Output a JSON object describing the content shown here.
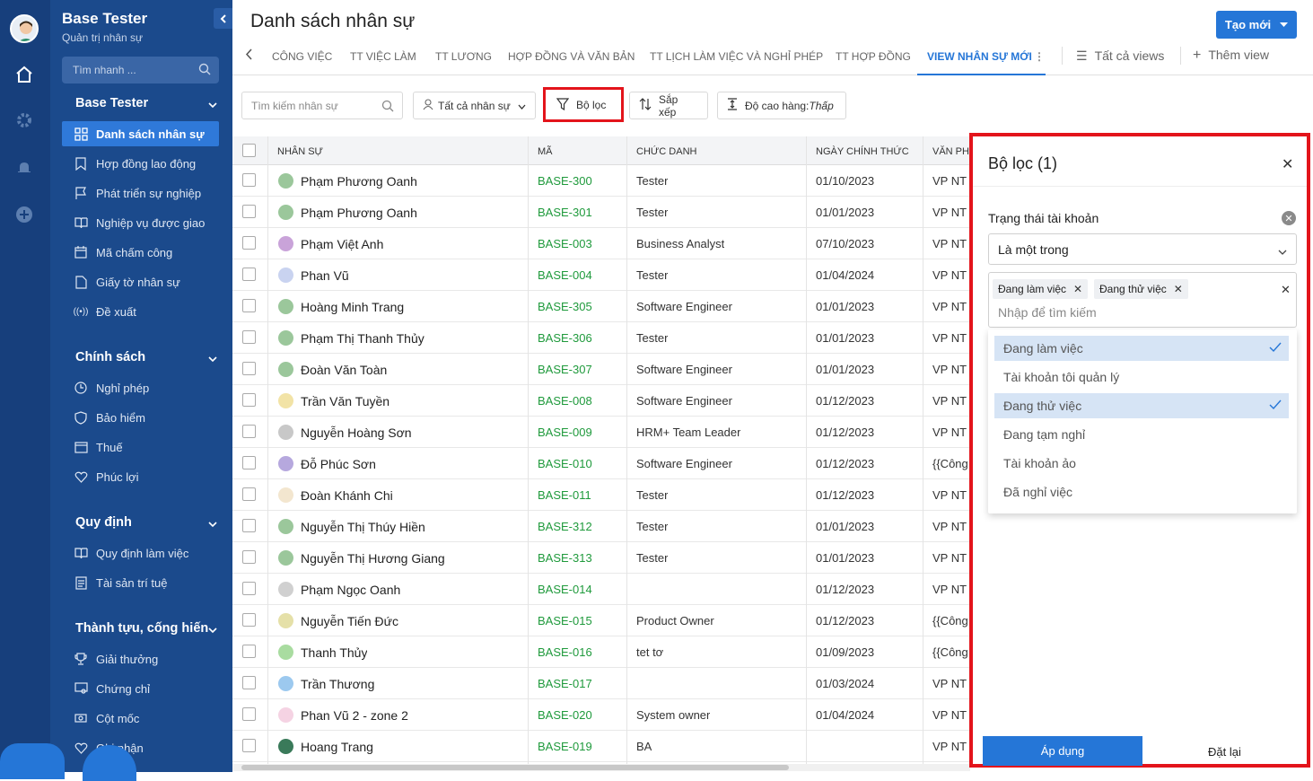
{
  "sidebar": {
    "app_title": "Base Tester",
    "app_subtitle": "Quản trị nhân sự",
    "search_placeholder": "Tìm nhanh ...",
    "sections": [
      {
        "title": "Base Tester",
        "items": [
          "Danh sách nhân sự",
          "Hợp đồng lao động",
          "Phát triển sự nghiệp",
          "Nghiệp vụ được giao",
          "Mã chấm công",
          "Giấy tờ nhân sự",
          "Đề xuất"
        ]
      },
      {
        "title": "Chính sách",
        "items": [
          "Nghỉ phép",
          "Bảo hiểm",
          "Thuế",
          "Phúc lợi"
        ]
      },
      {
        "title": "Quy định",
        "items": [
          "Quy định làm việc",
          "Tài sản trí tuệ"
        ]
      },
      {
        "title": "Thành tựu, cống hiến",
        "items": [
          "Giải thưởng",
          "Chứng chỉ",
          "Cột mốc",
          "Ghi nhận"
        ]
      }
    ]
  },
  "header": {
    "title": "Danh sách nhân sự",
    "create_button": "Tạo mới"
  },
  "tabs": [
    "CÔNG VIỆC",
    "TT VIỆC LÀM",
    "TT LƯƠNG",
    "HỢP ĐỒNG VÀ VĂN BẢN",
    "TT LỊCH LÀM VIỆC VÀ NGHỈ PHÉP",
    "TT HỢP ĐỒNG",
    "VIEW NHÂN SỰ MỚI"
  ],
  "views": {
    "all": "Tất cả views",
    "add": "Thêm view"
  },
  "toolbar": {
    "search_placeholder": "Tìm kiếm nhân sự",
    "all_staff": "Tất cả nhân sự",
    "filter": "Bộ lọc",
    "sort": "Sắp xếp",
    "row_height_label": "Độ cao hàng: ",
    "row_height_value": "Thấp"
  },
  "table": {
    "columns": [
      "NHÂN SỰ",
      "MÃ",
      "CHỨC DANH",
      "NGÀY CHÍNH THỨC",
      "VĂN PH"
    ],
    "rows": [
      {
        "name": "Phạm Phương Oanh",
        "code": "BASE-300",
        "title": "Tester",
        "date": "01/10/2023",
        "office": "VP NT",
        "avatar": "#9bc79b"
      },
      {
        "name": "Phạm Phương Oanh",
        "code": "BASE-301",
        "title": "Tester",
        "date": "01/01/2023",
        "office": "VP NT",
        "avatar": "#9bc79b"
      },
      {
        "name": "Phạm Việt Anh",
        "code": "BASE-003",
        "title": "Business Analyst",
        "date": "07/10/2023",
        "office": "VP NT",
        "avatar": "#c9a3d9"
      },
      {
        "name": "Phan Vũ",
        "code": "BASE-004",
        "title": "Tester",
        "date": "01/04/2024",
        "office": "VP NT",
        "avatar": "#c9d3f0"
      },
      {
        "name": "Hoàng Minh Trang",
        "code": "BASE-305",
        "title": "Software Engineer",
        "date": "01/01/2023",
        "office": "VP NT",
        "avatar": "#9bc79b"
      },
      {
        "name": "Phạm Thị Thanh Thủy",
        "code": "BASE-306",
        "title": "Tester",
        "date": "01/01/2023",
        "office": "VP NT",
        "avatar": "#9bc79b"
      },
      {
        "name": "Đoàn Văn Toàn",
        "code": "BASE-307",
        "title": "Software Engineer",
        "date": "01/01/2023",
        "office": "VP NT",
        "avatar": "#9bc79b"
      },
      {
        "name": "Trần Văn Tuyền",
        "code": "BASE-008",
        "title": "Software Engineer",
        "date": "01/12/2023",
        "office": "VP NT",
        "avatar": "#f2e3a6"
      },
      {
        "name": "Nguyễn Hoàng Sơn",
        "code": "BASE-009",
        "title": "HRM+ Team Leader",
        "date": "01/12/2023",
        "office": "VP NT",
        "avatar": "#c8c8c8"
      },
      {
        "name": "Đỗ Phúc Sơn",
        "code": "BASE-010",
        "title": "Software Engineer",
        "date": "01/12/2023",
        "office": "{{Công",
        "avatar": "#b6a8de"
      },
      {
        "name": "Đoàn Khánh Chi",
        "code": "BASE-011",
        "title": "Tester",
        "date": "01/12/2023",
        "office": "VP NT",
        "avatar": "#f3e6cf"
      },
      {
        "name": "Nguyễn Thị Thúy Hiền",
        "code": "BASE-312",
        "title": "Tester",
        "date": "01/01/2023",
        "office": "VP NT",
        "avatar": "#9bc79b"
      },
      {
        "name": "Nguyễn Thị Hương Giang",
        "code": "BASE-313",
        "title": "Tester",
        "date": "01/01/2023",
        "office": "VP NT",
        "avatar": "#9bc79b"
      },
      {
        "name": "Phạm Ngọc Oanh",
        "code": "BASE-014",
        "title": "",
        "date": "01/12/2023",
        "office": "VP NT",
        "avatar": "#d0d0d0"
      },
      {
        "name": "Nguyễn Tiến Đức",
        "code": "BASE-015",
        "title": "Product Owner",
        "date": "01/12/2023",
        "office": "{{Công",
        "avatar": "#e5e0a8"
      },
      {
        "name": "Thanh Thủy",
        "code": "BASE-016",
        "title": "tet tơ",
        "date": "01/09/2023",
        "office": "{{Công",
        "avatar": "#a9dca0"
      },
      {
        "name": "Trần Thương",
        "code": "BASE-017",
        "title": "",
        "date": "01/03/2024",
        "office": "VP NT",
        "avatar": "#9cc9ef"
      },
      {
        "name": "Phan Vũ 2 - zone 2",
        "code": "BASE-020",
        "title": "System owner",
        "date": "01/04/2024",
        "office": "VP NT",
        "avatar": "#f5d3e3"
      },
      {
        "name": "Hoang Trang",
        "code": "BASE-019",
        "title": "BA",
        "date": "",
        "office": "VP NT",
        "avatar": "#3a7a5a"
      }
    ]
  },
  "filter_panel": {
    "title": "Bộ lọc (1)",
    "field_label": "Trạng thái tài khoản",
    "operator": "Là một trong",
    "tags": [
      "Đang làm việc",
      "Đang thử việc"
    ],
    "input_placeholder": "Nhập để tìm kiếm",
    "options": [
      {
        "label": "Đang làm việc",
        "selected": true
      },
      {
        "label": "Tài khoản tôi quản lý",
        "selected": false
      },
      {
        "label": "Đang thử việc",
        "selected": true
      },
      {
        "label": "Đang tạm nghỉ",
        "selected": false
      },
      {
        "label": "Tài khoản ảo",
        "selected": false
      },
      {
        "label": "Đã nghỉ việc",
        "selected": false
      }
    ],
    "apply": "Áp dụng",
    "reset": "Đặt lại"
  },
  "colors": {
    "accent": "#2576d7",
    "sidebar": "#1b4a8c",
    "rail": "#173f7c",
    "highlight": "#e3141b",
    "code_green": "#1f9a3c"
  }
}
